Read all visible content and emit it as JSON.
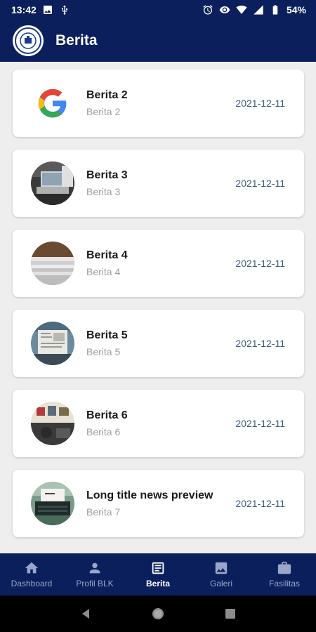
{
  "status_bar": {
    "time": "13:42",
    "battery": "54%"
  },
  "app_bar": {
    "title": "Berita"
  },
  "news": [
    {
      "title": "Berita 2",
      "subtitle": "Berita 2",
      "date": "2021-12-11",
      "thumb": "google-logo-icon"
    },
    {
      "title": "Berita 3",
      "subtitle": "Berita 3",
      "date": "2021-12-11",
      "thumb": "laptop-photo"
    },
    {
      "title": "Berita 4",
      "subtitle": "Berita 4",
      "date": "2021-12-11",
      "thumb": "newspaper-stack-photo"
    },
    {
      "title": "Berita 5",
      "subtitle": "Berita 5",
      "date": "2021-12-11",
      "thumb": "reading-newspaper-photo"
    },
    {
      "title": "Berita 6",
      "subtitle": "Berita 6",
      "date": "2021-12-11",
      "thumb": "newsroom-photo"
    },
    {
      "title": "Long title news preview",
      "subtitle": "Berita 7",
      "date": "2021-12-11",
      "thumb": "typewriter-photo"
    }
  ],
  "bottom_nav": [
    {
      "label": "Dashboard",
      "icon": "home-icon",
      "active": false
    },
    {
      "label": "Profil BLK",
      "icon": "person-icon",
      "active": false
    },
    {
      "label": "Berita",
      "icon": "article-icon",
      "active": true
    },
    {
      "label": "Galeri",
      "icon": "image-icon",
      "active": false
    },
    {
      "label": "Fasilitas",
      "icon": "briefcase-icon",
      "active": false
    }
  ],
  "colors": {
    "primary": "#0a1f5c",
    "date": "#3d5a80",
    "background": "#eeeeee"
  }
}
